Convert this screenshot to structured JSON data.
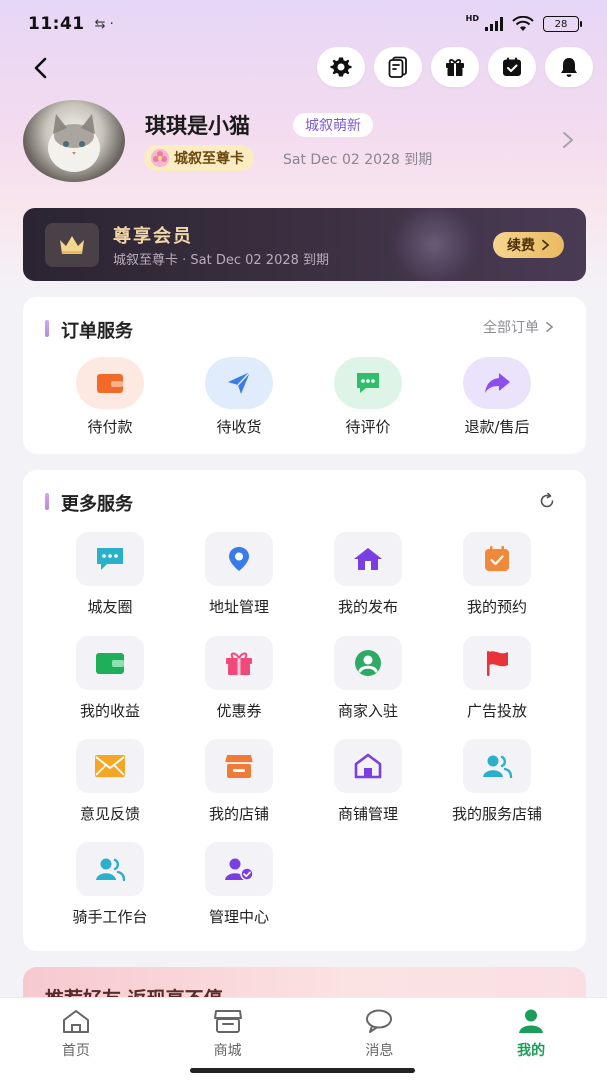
{
  "status_bar": {
    "time": "11:41",
    "battery": "28",
    "network": "HD"
  },
  "header": {
    "icons": [
      "gear-icon",
      "cards-icon",
      "gift-icon",
      "calendar-check-icon",
      "bell-icon"
    ]
  },
  "profile": {
    "nickname": "琪琪是小猫",
    "level": "城叙萌新",
    "card_name": "城叙至尊卡",
    "expire": "Sat Dec 02 2028 到期"
  },
  "vip": {
    "title": "尊享会员",
    "subtitle": "城叙至尊卡 · Sat Dec 02 2028 到期",
    "renew": "续费"
  },
  "orders": {
    "title": "订单服务",
    "all_label": "全部订单",
    "items": [
      {
        "label": "待付款",
        "icon": "wallet-icon",
        "bg": "#fde9e1",
        "color": "#f06a2a"
      },
      {
        "label": "待收货",
        "icon": "send-icon",
        "bg": "#e0ebfb",
        "color": "#3a7bea"
      },
      {
        "label": "待评价",
        "icon": "chat-icon",
        "bg": "#ddf4e6",
        "color": "#2fbf6b"
      },
      {
        "label": "退款/售后",
        "icon": "forward-arrow-icon",
        "bg": "#ebe3fb",
        "color": "#8b4ff0"
      }
    ]
  },
  "services": {
    "title": "更多服务",
    "items": [
      {
        "label": "城友圈",
        "icon": "chat-bubble-icon",
        "color": "#2ab0c9"
      },
      {
        "label": "地址管理",
        "icon": "location-pin-icon",
        "color": "#3a7bea"
      },
      {
        "label": "我的发布",
        "icon": "house-icon",
        "color": "#7a3fe0"
      },
      {
        "label": "我的预约",
        "icon": "calendar-check-icon",
        "color": "#f08a3a"
      },
      {
        "label": "我的收益",
        "icon": "wallet-icon",
        "color": "#1fae5a"
      },
      {
        "label": "优惠券",
        "icon": "gift-icon",
        "color": "#f04a7a"
      },
      {
        "label": "商家入驻",
        "icon": "user-circle-icon",
        "color": "#2faa66"
      },
      {
        "label": "广告投放",
        "icon": "flag-icon",
        "color": "#e8333a"
      },
      {
        "label": "意见反馈",
        "icon": "envelope-icon",
        "color": "#f5a623"
      },
      {
        "label": "我的店铺",
        "icon": "storefront-icon",
        "color": "#f07a3a"
      },
      {
        "label": "商铺管理",
        "icon": "home-outline-icon",
        "color": "#7a3fe0"
      },
      {
        "label": "我的服务店铺",
        "icon": "users-icon",
        "color": "#2ab0c9"
      },
      {
        "label": "骑手工作台",
        "icon": "users-icon",
        "color": "#2ab0c9"
      },
      {
        "label": "管理中心",
        "icon": "user-check-icon",
        "color": "#7a3fe0"
      }
    ]
  },
  "promo": {
    "text": "推荐好友 返现享不停"
  },
  "tabbar": {
    "tabs": [
      {
        "label": "首页",
        "icon": "home-icon"
      },
      {
        "label": "商城",
        "icon": "shop-icon"
      },
      {
        "label": "消息",
        "icon": "message-icon"
      },
      {
        "label": "我的",
        "icon": "person-icon"
      }
    ],
    "active_color": "#1b9e58"
  }
}
